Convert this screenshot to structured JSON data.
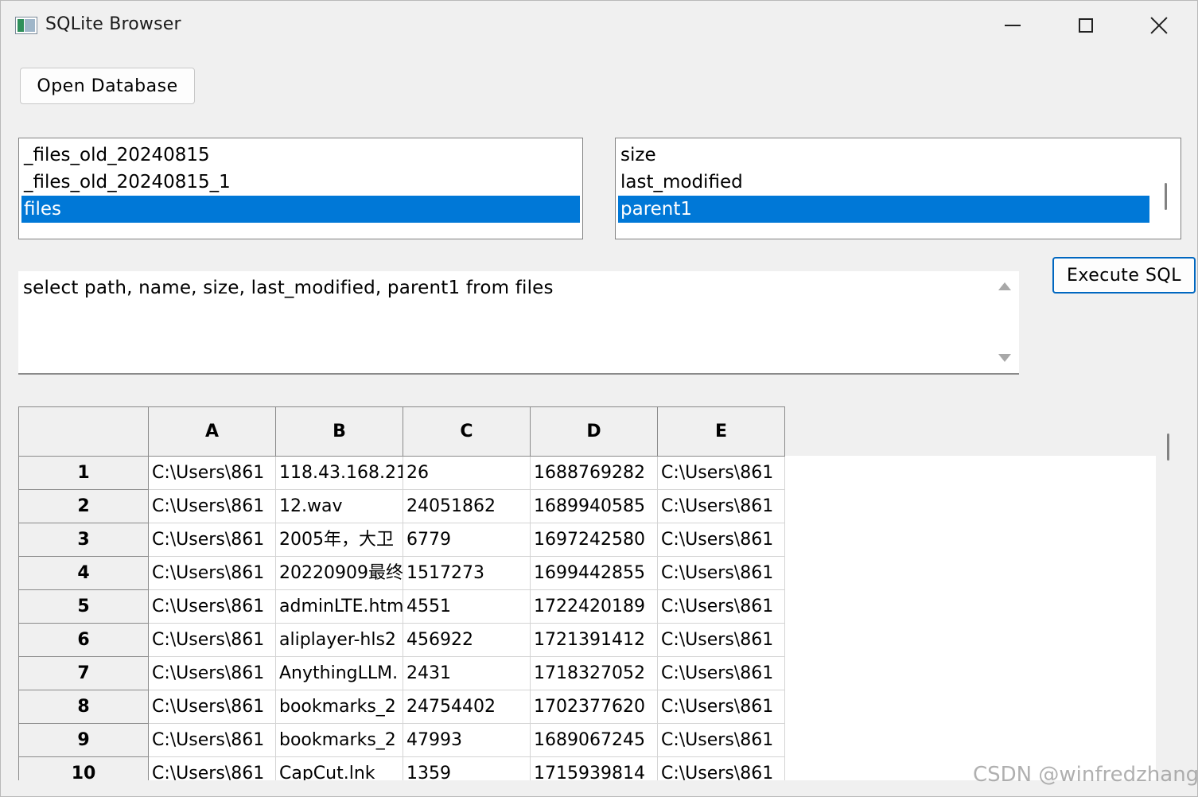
{
  "window": {
    "title": "SQLite Browser",
    "icon": "sqlite-app-icon",
    "controls": [
      "minimize-icon",
      "maximize-icon",
      "close-icon"
    ]
  },
  "toolbar": {
    "open_label": "Open Database",
    "execute_label": "Execute SQL"
  },
  "tables_list": {
    "items": [
      {
        "label": "_files_old_20240815",
        "selected": false
      },
      {
        "label": "_files_old_20240815_1",
        "selected": false
      },
      {
        "label": "files",
        "selected": true
      }
    ]
  },
  "columns_list": {
    "items": [
      {
        "label": "size",
        "selected": false
      },
      {
        "label": "last_modified",
        "selected": false
      },
      {
        "label": "parent1",
        "selected": true
      }
    ]
  },
  "sql_editor": {
    "value": "select path, name, size, last_modified, parent1 from files"
  },
  "grid": {
    "columns": [
      "A",
      "B",
      "C",
      "D",
      "E"
    ],
    "rows": [
      {
        "num": "1",
        "cells": [
          "C:\\Users\\861",
          "118.43.168.21",
          "26",
          "1688769282",
          "C:\\Users\\861"
        ]
      },
      {
        "num": "2",
        "cells": [
          "C:\\Users\\861",
          "12.wav",
          "24051862",
          "1689940585",
          "C:\\Users\\861"
        ]
      },
      {
        "num": "3",
        "cells": [
          "C:\\Users\\861",
          "2005年，大卫",
          "6779",
          "1697242580",
          "C:\\Users\\861"
        ]
      },
      {
        "num": "4",
        "cells": [
          "C:\\Users\\861",
          "20220909最终",
          "1517273",
          "1699442855",
          "C:\\Users\\861"
        ]
      },
      {
        "num": "5",
        "cells": [
          "C:\\Users\\861",
          "adminLTE.htm",
          "4551",
          "1722420189",
          "C:\\Users\\861"
        ]
      },
      {
        "num": "6",
        "cells": [
          "C:\\Users\\861",
          "aliplayer-hls2",
          "456922",
          "1721391412",
          "C:\\Users\\861"
        ]
      },
      {
        "num": "7",
        "cells": [
          "C:\\Users\\861",
          "AnythingLLM.",
          "2431",
          "1718327052",
          "C:\\Users\\861"
        ]
      },
      {
        "num": "8",
        "cells": [
          "C:\\Users\\861",
          "bookmarks_2",
          "24754402",
          "1702377620",
          "C:\\Users\\861"
        ]
      },
      {
        "num": "9",
        "cells": [
          "C:\\Users\\861",
          "bookmarks_2",
          "47993",
          "1689067245",
          "C:\\Users\\861"
        ]
      },
      {
        "num": "10",
        "cells": [
          "C:\\Users\\861",
          "CapCut.lnk",
          "1359",
          "1715939814",
          "C:\\Users\\861"
        ]
      }
    ]
  },
  "watermark": "CSDN @winfredzhang",
  "colors": {
    "selection": "#0078d7",
    "focus_border": "#0067c0",
    "window_bg": "#f0f0f0"
  }
}
